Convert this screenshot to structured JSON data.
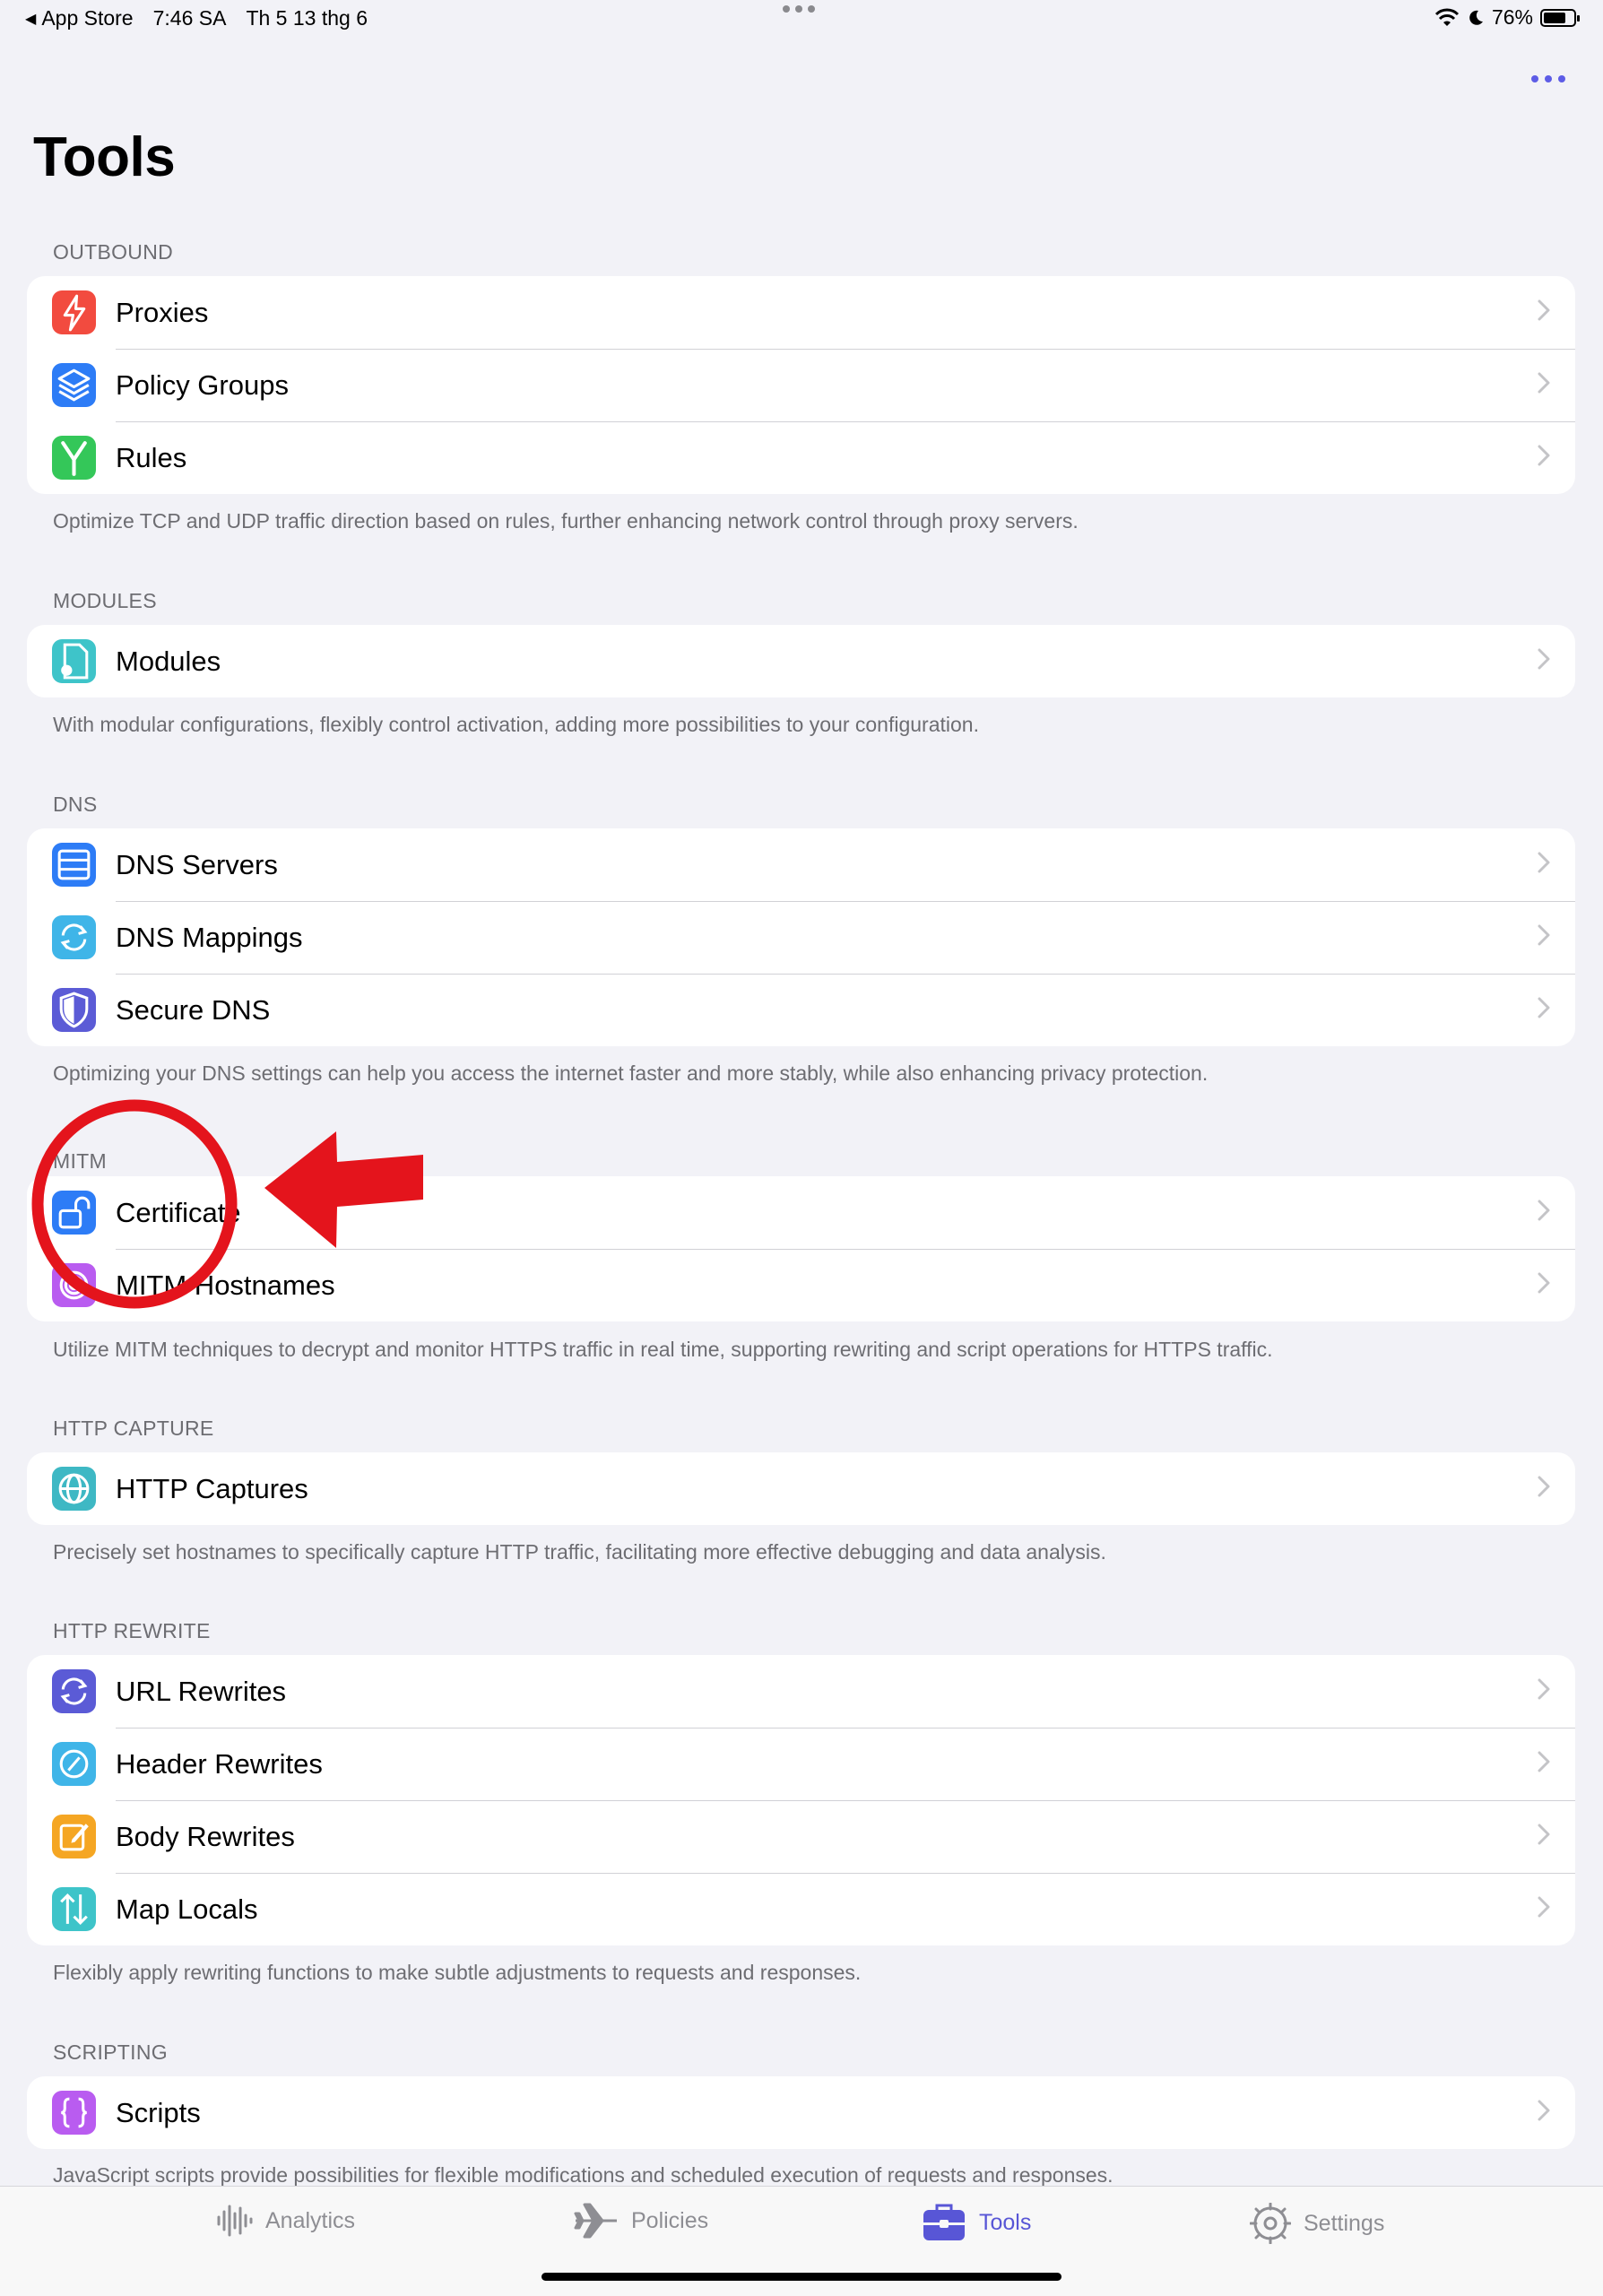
{
  "status_bar": {
    "back_app": "App Store",
    "time": "7:46 SA",
    "date": "Th 5 13 thg 6",
    "battery": "76%",
    "battery_level": 0.76
  },
  "page": {
    "title": "Tools"
  },
  "sections": [
    {
      "header": "OUTBOUND",
      "items": [
        {
          "label": "Proxies",
          "icon": "bolt-icon",
          "color": "#f24b3f"
        },
        {
          "label": "Policy Groups",
          "icon": "layers-icon",
          "color": "#2d7cf6"
        },
        {
          "label": "Rules",
          "icon": "branch-icon",
          "color": "#34c759"
        }
      ],
      "footer": "Optimize TCP and UDP traffic direction based on rules, further enhancing network control through proxy servers."
    },
    {
      "header": "MODULES",
      "items": [
        {
          "label": "Modules",
          "icon": "module-doc-icon",
          "color": "#3ec4c9"
        }
      ],
      "footer": "With modular configurations, flexibly control activation, adding more possibilities to your configuration."
    },
    {
      "header": "DNS",
      "items": [
        {
          "label": "DNS Servers",
          "icon": "server-icon",
          "color": "#2d7cf6"
        },
        {
          "label": "DNS Mappings",
          "icon": "sync-icon",
          "color": "#3fb5e8"
        },
        {
          "label": "Secure DNS",
          "icon": "shield-icon",
          "color": "#5b5bd6"
        }
      ],
      "footer": "Optimizing your DNS settings can help you access the internet faster and more stably, while also enhancing privacy protection."
    },
    {
      "header": "MITM",
      "items": [
        {
          "label": "Certificate",
          "icon": "unlock-icon",
          "color": "#2d7cf6"
        },
        {
          "label": "MITM Hostnames",
          "icon": "fingerprint-icon",
          "color": "#b95cf0"
        }
      ],
      "footer": "Utilize MITM techniques to decrypt and monitor HTTPS traffic in real time, supporting rewriting and script operations for HTTPS traffic."
    },
    {
      "header": "HTTP CAPTURE",
      "items": [
        {
          "label": "HTTP Captures",
          "icon": "globe-icon",
          "color": "#3eb8c4"
        }
      ],
      "footer": "Precisely set hostnames to specifically capture HTTP traffic, facilitating more effective debugging and data analysis."
    },
    {
      "header": "HTTP REWRITE",
      "items": [
        {
          "label": "URL Rewrites",
          "icon": "refresh-icon",
          "color": "#5b5bd6"
        },
        {
          "label": "Header Rewrites",
          "icon": "slash-circle-icon",
          "color": "#3fb5e8"
        },
        {
          "label": "Body Rewrites",
          "icon": "edit-icon",
          "color": "#f5a623"
        },
        {
          "label": "Map Locals",
          "icon": "up-down-arrows-icon",
          "color": "#3ec4c9"
        }
      ],
      "footer": "Flexibly apply rewriting functions to make subtle adjustments to requests and responses."
    },
    {
      "header": "SCRIPTING",
      "items": [
        {
          "label": "Scripts",
          "icon": "braces-icon",
          "color": "#b95cf0"
        }
      ],
      "footer": "JavaScript scripts provide possibilities for flexible modifications and scheduled execution of requests and responses."
    }
  ],
  "tab_bar": {
    "tabs": [
      {
        "label": "Analytics",
        "icon": "waveform-icon"
      },
      {
        "label": "Policies",
        "icon": "airplane-icon"
      },
      {
        "label": "Tools",
        "icon": "toolbox-icon",
        "active": true
      },
      {
        "label": "Settings",
        "icon": "gear-icon"
      }
    ]
  },
  "colors": {
    "accent": "#5856d6",
    "annotation": "#e4141c"
  }
}
